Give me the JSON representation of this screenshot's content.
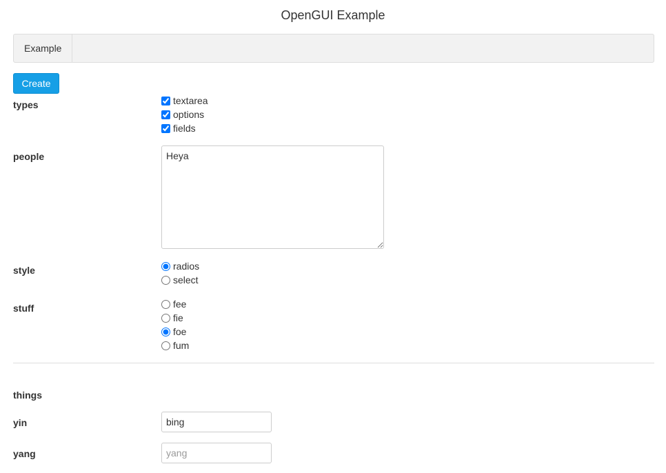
{
  "app": {
    "title": "OpenGUI Example"
  },
  "tabs": [
    {
      "label": "Example"
    }
  ],
  "toolbar": {
    "create_label": "Create"
  },
  "form": {
    "types": {
      "label": "types",
      "options": [
        {
          "label": "textarea",
          "checked": true
        },
        {
          "label": "options",
          "checked": true
        },
        {
          "label": "fields",
          "checked": true
        }
      ]
    },
    "people": {
      "label": "people",
      "value": "Heya"
    },
    "style": {
      "label": "style",
      "options": [
        {
          "label": "radios",
          "checked": true
        },
        {
          "label": "select",
          "checked": false
        }
      ]
    },
    "stuff": {
      "label": "stuff",
      "options": [
        {
          "label": "fee",
          "checked": false
        },
        {
          "label": "fie",
          "checked": false
        },
        {
          "label": "foe",
          "checked": true
        },
        {
          "label": "fum",
          "checked": false
        }
      ]
    },
    "things": {
      "label": "things"
    },
    "yin": {
      "label": "yin",
      "value": "bing",
      "placeholder": ""
    },
    "yang": {
      "label": "yang",
      "value": "",
      "placeholder": "yang"
    }
  },
  "colors": {
    "primary_button": "#169fe6",
    "tabbar_bg": "#f2f2f2",
    "divider": "#dddddd"
  }
}
